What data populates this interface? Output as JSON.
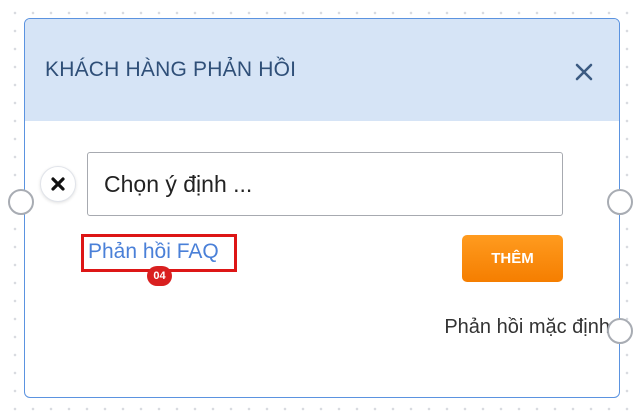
{
  "node": {
    "title": "KHÁCH HÀNG PHẢN HỒI",
    "intent_placeholder": "Chọn ý định ...",
    "faq_link_label": "Phản hồi FAQ",
    "step_badge": "04",
    "add_button_label": "THÊM",
    "default_response_label": "Phản hồi mặc định"
  },
  "icons": {
    "close": "close-icon",
    "remove": "remove-x-icon"
  },
  "colors": {
    "header_background": "#d6e4f6",
    "card_border": "#5b93e0",
    "title_text": "#2f4f78",
    "link_text": "#4a80d8",
    "add_button": "#f57e00",
    "highlight": "#dd1616"
  }
}
